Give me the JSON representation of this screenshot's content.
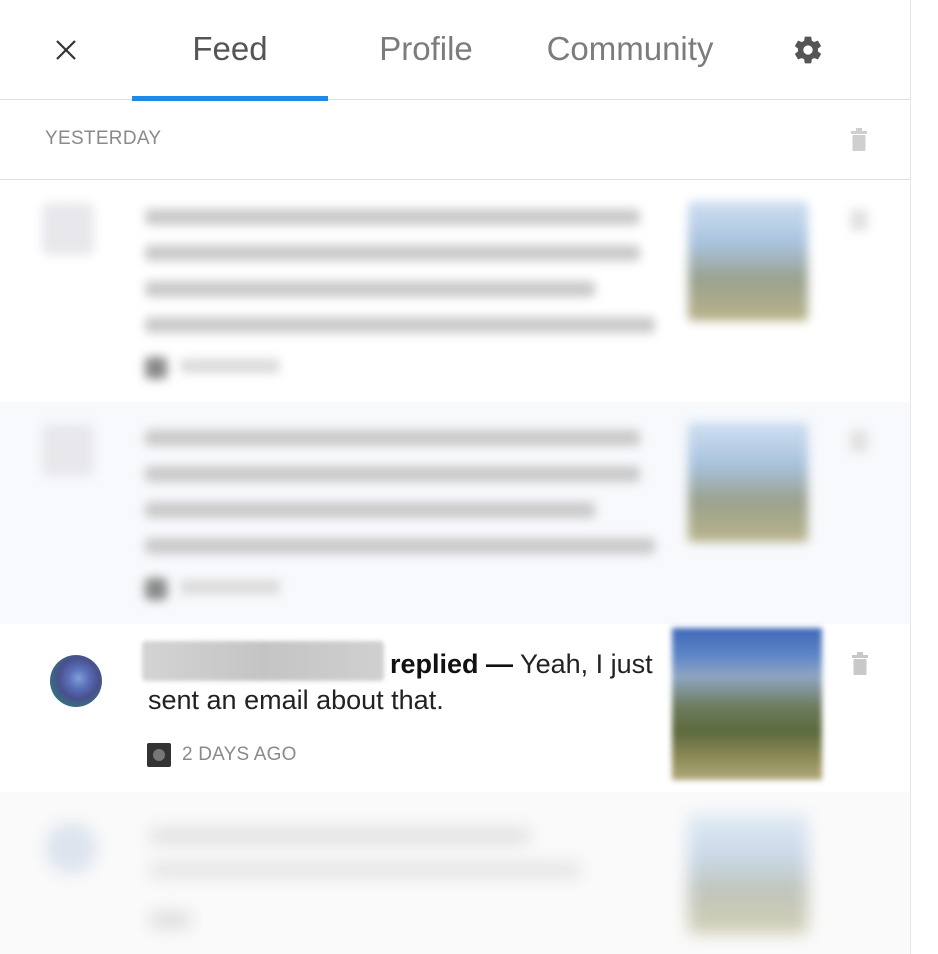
{
  "header": {
    "tabs": [
      {
        "label": "Feed",
        "active": true
      },
      {
        "label": "Profile",
        "active": false
      },
      {
        "label": "Community",
        "active": false
      }
    ],
    "accent_color": "#1e8ae6"
  },
  "section": {
    "label": "YESTERDAY"
  },
  "notification": {
    "action": "replied —",
    "message": "Yeah, I just sent an email about that.",
    "time": "2 DAYS AGO"
  },
  "icons": [
    "close-icon",
    "gear-icon",
    "trash-icon",
    "source-app-icon"
  ]
}
